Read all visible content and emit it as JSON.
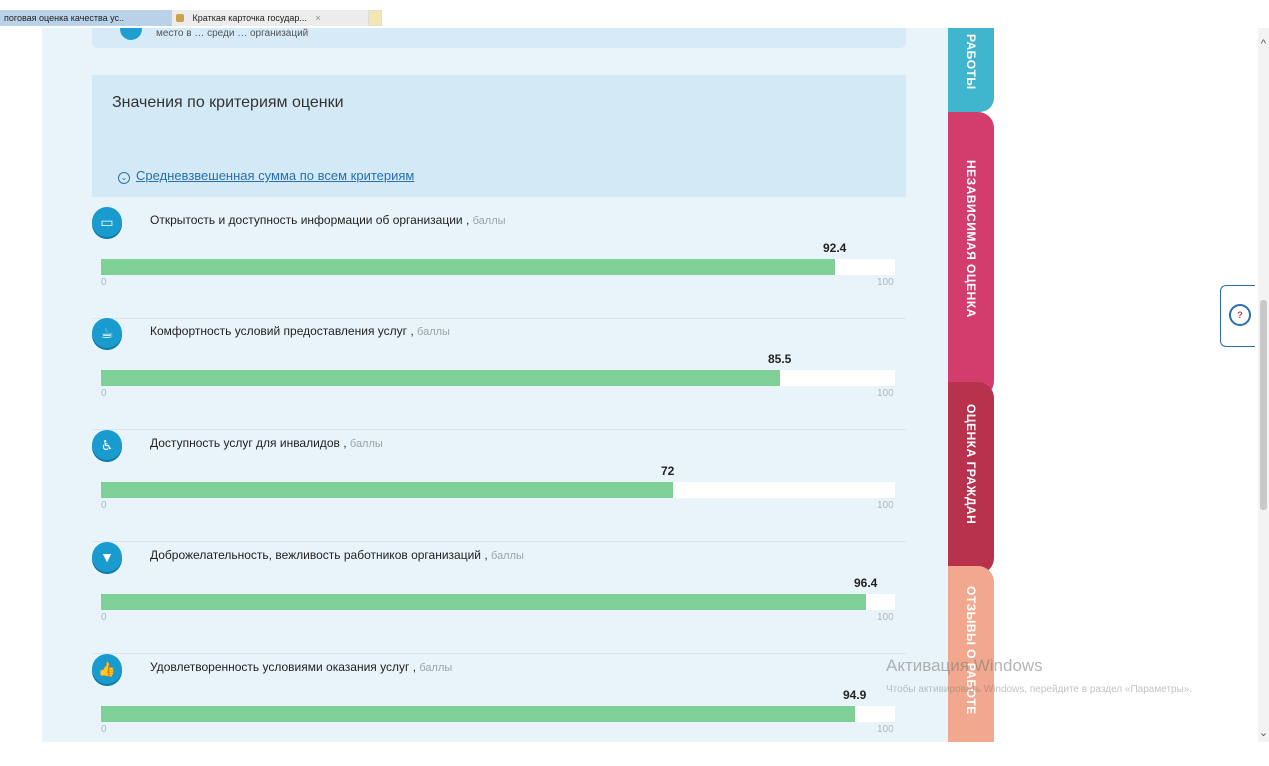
{
  "browser": {
    "tabs": [
      {
        "label": "поговая оценка качества ус.."
      },
      {
        "label": "Краткая карточка государ...",
        "close": "×"
      }
    ]
  },
  "previous_card": {
    "text": "место в … среди … организаций"
  },
  "criteria": {
    "title": "Значения по критериям оценки",
    "weighted_link": "Средневзвешенная сумма по всем критериям",
    "items": [
      {
        "label": "Открытость и доступность информации об организации",
        "unit": "баллы",
        "value": "92.4",
        "value_num": 92.4,
        "min": "0",
        "max": "100",
        "icon": "inbox-icon",
        "glyph": "▭"
      },
      {
        "label": "Комфортность условий предоставления услуг",
        "unit": "баллы",
        "value": "85.5",
        "value_num": 85.5,
        "min": "0",
        "max": "100",
        "icon": "cup-icon",
        "glyph": "☕"
      },
      {
        "label": "Доступность услуг для инвалидов",
        "unit": "баллы",
        "value": "72",
        "value_num": 72,
        "min": "0",
        "max": "100",
        "icon": "wheelchair-icon",
        "glyph": "♿"
      },
      {
        "label": "Доброжелательность, вежливость работников организаций",
        "unit": "баллы",
        "value": "96.4",
        "value_num": 96.4,
        "min": "0",
        "max": "100",
        "icon": "tie-icon",
        "glyph": "▼"
      },
      {
        "label": "Удовлетворенность условиями оказания услуг",
        "unit": "баллы",
        "value": "94.9",
        "value_num": 94.9,
        "min": "0",
        "max": "100",
        "icon": "thumbs-up-icon",
        "glyph": "👍"
      }
    ]
  },
  "side_tabs": {
    "works": "РАБОТЫ",
    "independent": "НЕЗАВИСИМАЯ ОЦЕНКА",
    "citizens": "ОЦЕНКА ГРАЖДАН",
    "reviews": "ОТЗЫВЫ О РАБОТЕ"
  },
  "watermark": {
    "title": "Активация Windows",
    "subtitle": "Чтобы активировать Windows, перейдите в раздел «Параметры»."
  },
  "colors": {
    "bar_fill": "#7fd096",
    "icon_blue": "#1a9bcf",
    "tab_works": "#3fb6cd",
    "tab_independent": "#d23d6e",
    "tab_citizens": "#b8324e",
    "tab_reviews": "#f2a88e"
  }
}
